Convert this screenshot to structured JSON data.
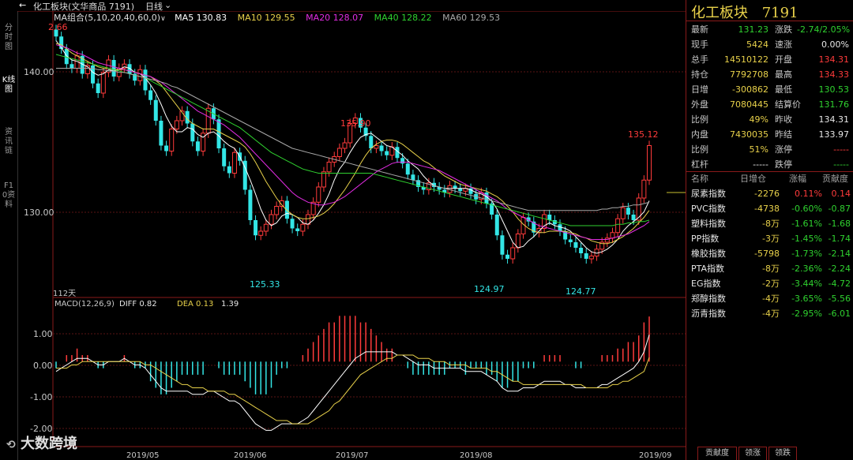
{
  "left_tabs": [
    "分时图",
    "K线图",
    "资讯链",
    "F10资料"
  ],
  "topbar": {
    "title": "化工板块(文华商品 7191)",
    "period": "日线",
    "ma_label": "MA组合(5,10,20,40,60,0)",
    "ma5": "MA5 130.83",
    "ma10": "MA10 129.55",
    "ma20": "MA20 128.07",
    "ma40": "MA40 128.22",
    "ma60": "MA60 129.53"
  },
  "price_axis": {
    "labels": [
      "140.00",
      "130.00"
    ],
    "top_left_value": "2.66"
  },
  "annotations": {
    "high1": "135.90",
    "high2": "135.12",
    "low1": "125.33",
    "low2": "124.97",
    "low3": "124.77",
    "days": "112天"
  },
  "macd": {
    "label": "MACD(12,26,9)",
    "diff": "DIFF 0.82",
    "dea": "DEA 0.13",
    "macd": "1.39",
    "axis": [
      "1.00",
      "0.00",
      "-1.00",
      "-2.00"
    ]
  },
  "dates": [
    "2019/05",
    "2019/06",
    "2019/07",
    "2019/08",
    "2019/09"
  ],
  "chart_data": {
    "type": "line",
    "title": "化工板块(文华商品 7191)",
    "ylim": [
      123,
      143
    ],
    "macd_ylim": [
      -2.5,
      1.6
    ],
    "close_series": [
      141.5,
      140.6,
      139.5,
      139.2,
      140.1,
      138.8,
      139.4,
      138.1,
      137.4,
      138.9,
      139.8,
      138.6,
      139.2,
      139.5,
      138.8,
      138.3,
      139.1,
      137.6,
      136.9,
      135.4,
      133.6,
      133.2,
      134.8,
      135.4,
      136.1,
      135.2,
      133.9,
      133.2,
      134.5,
      136.3,
      135.5,
      133.4,
      132.1,
      131.6,
      133.1,
      132.5,
      130.4,
      128.2,
      127.1,
      127.4,
      127.9,
      128.6,
      129.2,
      129.6,
      128.3,
      127.6,
      127.4,
      127.9,
      128.6,
      129.5,
      130.6,
      131.7,
      132.4,
      132.8,
      133.4,
      133.8,
      135.2,
      135.6,
      134.9,
      134.3,
      133.4,
      133.6,
      133.2,
      132.9,
      133.5,
      132.7,
      132.3,
      131.5,
      131.1,
      130.6,
      130.4,
      130.9,
      130.6,
      130.4,
      130.2,
      130.7,
      130.5,
      130.3,
      130.5,
      130.1,
      129.7,
      130.2,
      129.4,
      128.6,
      127.1,
      125.7,
      125.4,
      126.2,
      127.2,
      128.4,
      128.1,
      127.3,
      127.6,
      128.6,
      128.2,
      127.9,
      127.4,
      126.8,
      126.6,
      126.2,
      125.8,
      125.4,
      125.6,
      126.1,
      126.6,
      126.9,
      127.3,
      128.3,
      129.1,
      128.6,
      128.2,
      129.8,
      131.1,
      133.6
    ],
    "series": [
      {
        "name": "MA5",
        "color": "#ffffff",
        "values": [
          141.2,
          140.7,
          140.1,
          139.8,
          139.7,
          139.5,
          139.3,
          138.9,
          138.7,
          138.8,
          139.1,
          139.0,
          139.1,
          139.3,
          139.2,
          138.9,
          138.8,
          138.5,
          138.0,
          137.4,
          136.6,
          135.7,
          135.0,
          134.6,
          134.6,
          134.9,
          134.8,
          134.4,
          134.2,
          134.5,
          134.6,
          134.3,
          133.9,
          133.6,
          133.4,
          132.8,
          132.0,
          131.1,
          130.1,
          129.0,
          128.2,
          127.8,
          128.0,
          128.5,
          128.7,
          128.6,
          128.4,
          128.0,
          127.9,
          128.2,
          128.7,
          129.3,
          130.1,
          131.1,
          131.9,
          132.4,
          133.1,
          133.7,
          134.2,
          134.4,
          134.5,
          134.2,
          133.9,
          133.6,
          133.5,
          133.2,
          132.9,
          132.5,
          132.2,
          131.9,
          131.4,
          131.0,
          130.7,
          130.6,
          130.5,
          130.5,
          130.5,
          130.5,
          130.5,
          130.4,
          130.2,
          130.1,
          129.9,
          129.6,
          129.0,
          128.2,
          127.4,
          126.6,
          126.2,
          126.3,
          126.7,
          127.0,
          127.4,
          127.8,
          128.0,
          127.8,
          127.7,
          127.6,
          127.4,
          127.0,
          126.6,
          126.2,
          125.9,
          125.8,
          125.9,
          126.1,
          126.4,
          126.8,
          127.4,
          127.8,
          128.1,
          128.4,
          128.8,
          129.6
        ]
      },
      {
        "name": "MA10",
        "color": "#e8d14a",
        "values": [
          141.0,
          140.9,
          140.6,
          140.3,
          140.1,
          139.9,
          139.7,
          139.5,
          139.3,
          139.2,
          139.2,
          139.1,
          139.1,
          139.1,
          139.0,
          138.9,
          138.8,
          138.7,
          138.6,
          138.3,
          138.0,
          137.5,
          137.0,
          136.5,
          136.0,
          135.5,
          135.2,
          135.0,
          134.8,
          134.8,
          134.8,
          134.6,
          134.4,
          134.2,
          134.0,
          133.8,
          133.5,
          133.0,
          132.4,
          131.7,
          131.0,
          130.4,
          129.8,
          129.3,
          128.9,
          128.6,
          128.4,
          128.3,
          128.3,
          128.4,
          128.5,
          128.7,
          129.0,
          129.4,
          129.9,
          130.4,
          131.0,
          131.6,
          132.3,
          132.9,
          133.4,
          133.7,
          133.9,
          134.0,
          134.0,
          133.9,
          133.7,
          133.4,
          133.1,
          132.8,
          132.5,
          132.3,
          132.0,
          131.7,
          131.4,
          131.2,
          131.0,
          130.8,
          130.7,
          130.6,
          130.5,
          130.4,
          130.3,
          130.1,
          129.9,
          129.6,
          129.2,
          128.8,
          128.3,
          127.9,
          127.6,
          127.4,
          127.3,
          127.3,
          127.4,
          127.4,
          127.4,
          127.4,
          127.3,
          127.2,
          127.0,
          126.9,
          126.7,
          126.6,
          126.5,
          126.5,
          126.6,
          126.8,
          127.0,
          127.3,
          127.6,
          128.0,
          128.4,
          128.9
        ]
      },
      {
        "name": "MA20",
        "color": "#e22ce2",
        "values": [
          140.9,
          140.8,
          140.7,
          140.5,
          140.3,
          140.2,
          140.0,
          139.8,
          139.6,
          139.5,
          139.4,
          139.3,
          139.2,
          139.1,
          139.0,
          138.9,
          138.8,
          138.7,
          138.6,
          138.4,
          138.2,
          137.9,
          137.6,
          137.3,
          137.0,
          136.7,
          136.4,
          136.1,
          135.9,
          135.7,
          135.5,
          135.3,
          135.1,
          134.8,
          134.5,
          134.2,
          133.8,
          133.4,
          133.0,
          132.6,
          132.2,
          131.8,
          131.4,
          131.0,
          130.6,
          130.2,
          129.9,
          129.7,
          129.5,
          129.4,
          129.3,
          129.3,
          129.4,
          129.5,
          129.7,
          129.9,
          130.2,
          130.5,
          130.8,
          131.1,
          131.4,
          131.7,
          131.9,
          132.1,
          132.3,
          132.4,
          132.4,
          132.4,
          132.3,
          132.2,
          132.1,
          132.0,
          131.9,
          131.8,
          131.6,
          131.4,
          131.2,
          131.0,
          130.8,
          130.6,
          130.4,
          130.2,
          130.0,
          129.8,
          129.6,
          129.3,
          129.0,
          128.8,
          128.6,
          128.4,
          128.2,
          128.0,
          127.8,
          127.7,
          127.6,
          127.5,
          127.4,
          127.3,
          127.2,
          127.1,
          127.0,
          126.9,
          126.8,
          126.8,
          126.8,
          126.8,
          126.9,
          127.0,
          127.1,
          127.2,
          127.4,
          127.6,
          127.8,
          128.1
        ]
      },
      {
        "name": "MA40",
        "color": "#2fd12f",
        "values": [
          140.2,
          140.1,
          140.0,
          139.9,
          139.8,
          139.7,
          139.6,
          139.5,
          139.4,
          139.3,
          139.2,
          139.1,
          139.0,
          138.9,
          138.8,
          138.7,
          138.6,
          138.5,
          138.3,
          138.1,
          137.9,
          137.7,
          137.5,
          137.3,
          137.1,
          136.9,
          136.7,
          136.5,
          136.3,
          136.1,
          135.9,
          135.7,
          135.5,
          135.3,
          135.1,
          134.9,
          134.6,
          134.3,
          134.0,
          133.7,
          133.4,
          133.1,
          132.9,
          132.7,
          132.5,
          132.3,
          132.1,
          131.9,
          131.8,
          131.7,
          131.6,
          131.6,
          131.6,
          131.6,
          131.6,
          131.6,
          131.6,
          131.6,
          131.6,
          131.6,
          131.6,
          131.5,
          131.4,
          131.3,
          131.2,
          131.1,
          131.0,
          130.9,
          130.8,
          130.7,
          130.6,
          130.5,
          130.4,
          130.3,
          130.2,
          130.1,
          130.0,
          129.9,
          129.8,
          129.7,
          129.6,
          129.5,
          129.4,
          129.3,
          129.2,
          129.1,
          129.0,
          128.9,
          128.8,
          128.7,
          128.6,
          128.5,
          128.4,
          128.3,
          128.2,
          128.1,
          128.0,
          127.9,
          127.8,
          127.8,
          127.8,
          127.8,
          127.8,
          127.8,
          127.8,
          127.8,
          127.8,
          127.9,
          127.9,
          128.0,
          128.0,
          128.1,
          128.1,
          128.2
        ]
      },
      {
        "name": "MA60",
        "color": "#a8a8a8",
        "values": [
          139.2,
          139.2,
          139.2,
          139.2,
          139.2,
          139.2,
          139.2,
          139.2,
          139.1,
          139.1,
          139.0,
          139.0,
          138.9,
          138.9,
          138.8,
          138.7,
          138.6,
          138.5,
          138.4,
          138.3,
          138.2,
          138.1,
          137.9,
          137.8,
          137.6,
          137.4,
          137.2,
          137.0,
          136.8,
          136.6,
          136.4,
          136.2,
          136.0,
          135.8,
          135.6,
          135.4,
          135.2,
          135.0,
          134.8,
          134.6,
          134.4,
          134.2,
          134.0,
          133.8,
          133.6,
          133.4,
          133.3,
          133.2,
          133.1,
          133.0,
          132.9,
          132.8,
          132.7,
          132.6,
          132.5,
          132.4,
          132.3,
          132.2,
          132.1,
          132.0,
          131.9,
          131.8,
          131.7,
          131.6,
          131.5,
          131.4,
          131.3,
          131.2,
          131.1,
          131.0,
          130.9,
          130.8,
          130.7,
          130.6,
          130.5,
          130.4,
          130.3,
          130.2,
          130.1,
          130.0,
          129.9,
          129.8,
          129.7,
          129.6,
          129.5,
          129.4,
          129.3,
          129.2,
          129.1,
          129.0,
          128.9,
          128.9,
          128.9,
          128.9,
          128.9,
          128.9,
          128.9,
          128.9,
          128.9,
          128.9,
          128.9,
          128.9,
          128.9,
          128.9,
          129.0,
          129.0,
          129.1,
          129.1,
          129.2,
          129.2,
          129.3,
          129.3,
          129.4,
          129.5
        ]
      }
    ],
    "macd_diff": [
      -0.3,
      -0.2,
      -0.1,
      0.0,
      0.1,
      0.1,
      0.1,
      0.0,
      -0.1,
      -0.1,
      0.0,
      0.0,
      0.0,
      0.1,
      0.0,
      -0.1,
      -0.1,
      -0.2,
      -0.4,
      -0.6,
      -0.8,
      -0.9,
      -0.9,
      -0.9,
      -0.9,
      -0.9,
      -1.0,
      -1.0,
      -1.0,
      -0.9,
      -0.9,
      -1.0,
      -1.1,
      -1.2,
      -1.2,
      -1.3,
      -1.5,
      -1.7,
      -1.9,
      -2.0,
      -2.1,
      -2.1,
      -2.0,
      -1.9,
      -1.9,
      -1.9,
      -1.9,
      -1.8,
      -1.7,
      -1.5,
      -1.3,
      -1.1,
      -0.9,
      -0.7,
      -0.5,
      -0.3,
      -0.1,
      0.1,
      0.2,
      0.3,
      0.3,
      0.3,
      0.3,
      0.3,
      0.3,
      0.2,
      0.2,
      0.1,
      0.0,
      -0.1,
      -0.1,
      -0.1,
      -0.2,
      -0.2,
      -0.2,
      -0.2,
      -0.2,
      -0.2,
      -0.3,
      -0.3,
      -0.3,
      -0.3,
      -0.4,
      -0.5,
      -0.6,
      -0.8,
      -0.9,
      -0.9,
      -0.9,
      -0.8,
      -0.8,
      -0.8,
      -0.7,
      -0.6,
      -0.6,
      -0.6,
      -0.6,
      -0.7,
      -0.7,
      -0.8,
      -0.8,
      -0.8,
      -0.8,
      -0.8,
      -0.7,
      -0.7,
      -0.6,
      -0.5,
      -0.4,
      -0.3,
      -0.2,
      0.0,
      0.3,
      0.82
    ],
    "macd_dea": [
      -0.2,
      -0.2,
      -0.2,
      -0.1,
      -0.1,
      0.0,
      0.0,
      0.0,
      0.0,
      0.0,
      0.0,
      0.0,
      0.0,
      0.0,
      0.0,
      0.0,
      0.0,
      -0.1,
      -0.1,
      -0.2,
      -0.3,
      -0.4,
      -0.5,
      -0.6,
      -0.7,
      -0.7,
      -0.8,
      -0.8,
      -0.8,
      -0.9,
      -0.9,
      -0.9,
      -0.9,
      -1.0,
      -1.0,
      -1.1,
      -1.2,
      -1.3,
      -1.4,
      -1.5,
      -1.6,
      -1.7,
      -1.8,
      -1.8,
      -1.8,
      -1.9,
      -1.9,
      -1.9,
      -1.9,
      -1.8,
      -1.7,
      -1.6,
      -1.5,
      -1.3,
      -1.2,
      -1.0,
      -0.8,
      -0.6,
      -0.4,
      -0.3,
      -0.2,
      -0.1,
      0.0,
      0.1,
      0.1,
      0.2,
      0.2,
      0.2,
      0.2,
      0.1,
      0.1,
      0.1,
      0.0,
      0.0,
      0.0,
      -0.1,
      -0.1,
      -0.1,
      -0.1,
      -0.2,
      -0.2,
      -0.2,
      -0.2,
      -0.3,
      -0.3,
      -0.4,
      -0.5,
      -0.6,
      -0.6,
      -0.7,
      -0.7,
      -0.7,
      -0.7,
      -0.7,
      -0.7,
      -0.7,
      -0.7,
      -0.7,
      -0.7,
      -0.7,
      -0.7,
      -0.8,
      -0.8,
      -0.8,
      -0.8,
      -0.8,
      -0.7,
      -0.7,
      -0.6,
      -0.6,
      -0.5,
      -0.4,
      -0.3,
      0.13
    ]
  },
  "right_panel": {
    "title": "化工板块",
    "code": "7191",
    "quote_rows": [
      {
        "l1": "最新",
        "v1": "131.23",
        "c1": "grn",
        "l2": "涨跌",
        "v2": "-2.74/2.05%",
        "c2": "grn"
      },
      {
        "l1": "现手",
        "v1": "5424",
        "c1": "yel",
        "l2": "速涨",
        "v2": "0.00%",
        "c2": "wht"
      },
      {
        "l1": "总手",
        "v1": "14510122",
        "c1": "yel",
        "l2": "开盘",
        "v2": "134.31",
        "c2": "red"
      },
      {
        "l1": "持仓",
        "v1": "7792708",
        "c1": "yel",
        "l2": "最高",
        "v2": "134.33",
        "c2": "red"
      },
      {
        "l1": "日增",
        "v1": "-300862",
        "c1": "yel",
        "l2": "最低",
        "v2": "130.53",
        "c2": "grn"
      },
      {
        "l1": "外盘",
        "v1": "7080445",
        "c1": "yel",
        "l2": "结算价",
        "v2": "131.76",
        "c2": "grn"
      },
      {
        "l1": "比例",
        "v1": "49%",
        "c1": "yel",
        "l2": "昨收",
        "v2": "134.31",
        "c2": "wht"
      },
      {
        "l1": "内盘",
        "v1": "7430035",
        "c1": "yel",
        "l2": "昨结",
        "v2": "133.97",
        "c2": "wht"
      },
      {
        "l1": "比例",
        "v1": "51%",
        "c1": "yel",
        "l2": "涨停",
        "v2": "-----",
        "c2": "red"
      },
      {
        "l1": "杠杆",
        "v1": "-----",
        "c1": "wht",
        "l2": "跌停",
        "v2": "-----",
        "c2": "grn"
      }
    ],
    "table_header": [
      "名称",
      "日增仓",
      "涨幅",
      "贡献度"
    ],
    "table_rows": [
      {
        "name": "尿素指数",
        "inc": "-2276",
        "chg": "0.11%",
        "chg_c": "red",
        "contrib": "0.14",
        "con_c": "red"
      },
      {
        "name": "PVC指数",
        "inc": "-4738",
        "chg": "-0.60%",
        "chg_c": "grn",
        "contrib": "-0.87",
        "con_c": "grn"
      },
      {
        "name": "塑料指数",
        "inc": "-8万",
        "chg": "-1.61%",
        "chg_c": "grn",
        "contrib": "-1.68",
        "con_c": "grn"
      },
      {
        "name": "PP指数",
        "inc": "-3万",
        "chg": "-1.45%",
        "chg_c": "grn",
        "contrib": "-1.74",
        "con_c": "grn"
      },
      {
        "name": "橡胶指数",
        "inc": "-5798",
        "chg": "-1.73%",
        "chg_c": "grn",
        "contrib": "-2.14",
        "con_c": "grn"
      },
      {
        "name": "PTA指数",
        "inc": "-8万",
        "chg": "-2.36%",
        "chg_c": "grn",
        "contrib": "-2.24",
        "con_c": "grn"
      },
      {
        "name": "EG指数",
        "inc": "-2万",
        "chg": "-3.44%",
        "chg_c": "grn",
        "contrib": "-4.72",
        "con_c": "grn"
      },
      {
        "name": "郑醇指数",
        "inc": "-4万",
        "chg": "-3.65%",
        "chg_c": "grn",
        "contrib": "-5.56",
        "con_c": "grn"
      },
      {
        "name": "沥青指数",
        "inc": "-4万",
        "chg": "-2.95%",
        "chg_c": "grn",
        "contrib": "-6.01",
        "con_c": "grn"
      }
    ],
    "bottom_tabs": [
      "贡献度",
      "领涨",
      "领跌"
    ]
  },
  "watermark": "大数跨境"
}
